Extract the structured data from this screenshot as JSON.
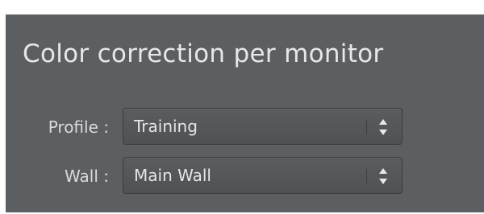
{
  "panel": {
    "title": "Color correction per monitor"
  },
  "profile": {
    "label": "Profile :",
    "value": "Training",
    "arrows_icon": "updown-arrows-icon"
  },
  "wall": {
    "label": "Wall :",
    "value": "Main Wall",
    "arrows_icon": "updown-arrows-icon"
  },
  "colors": {
    "panel_bg": "#5c5f61",
    "title_text": "#e6e7e8",
    "label_text": "#d8dadb"
  }
}
